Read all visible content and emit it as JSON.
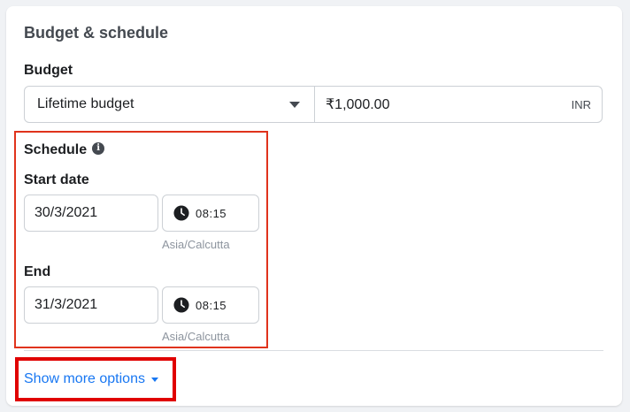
{
  "section": {
    "title": "Budget & schedule"
  },
  "budget": {
    "label": "Budget",
    "type_selected": "Lifetime budget",
    "amount": "₹1,000.00",
    "currency": "INR"
  },
  "schedule": {
    "label": "Schedule",
    "info_glyph": "i",
    "start": {
      "label": "Start date",
      "date": "30/3/2021",
      "time": "08:15",
      "timezone": "Asia/Calcutta"
    },
    "end": {
      "label": "End",
      "date": "31/3/2021",
      "time": "08:15",
      "timezone": "Asia/Calcutta"
    }
  },
  "more_options": {
    "label": "Show more options"
  },
  "colors": {
    "accent_link": "#1877f2",
    "highlight_schedule": "#e0331c",
    "highlight_more": "#e00000"
  },
  "icons": {
    "dropdown": "caret-down-icon",
    "info": "info-icon",
    "clock": "clock-icon",
    "more": "chevron-down-icon"
  }
}
